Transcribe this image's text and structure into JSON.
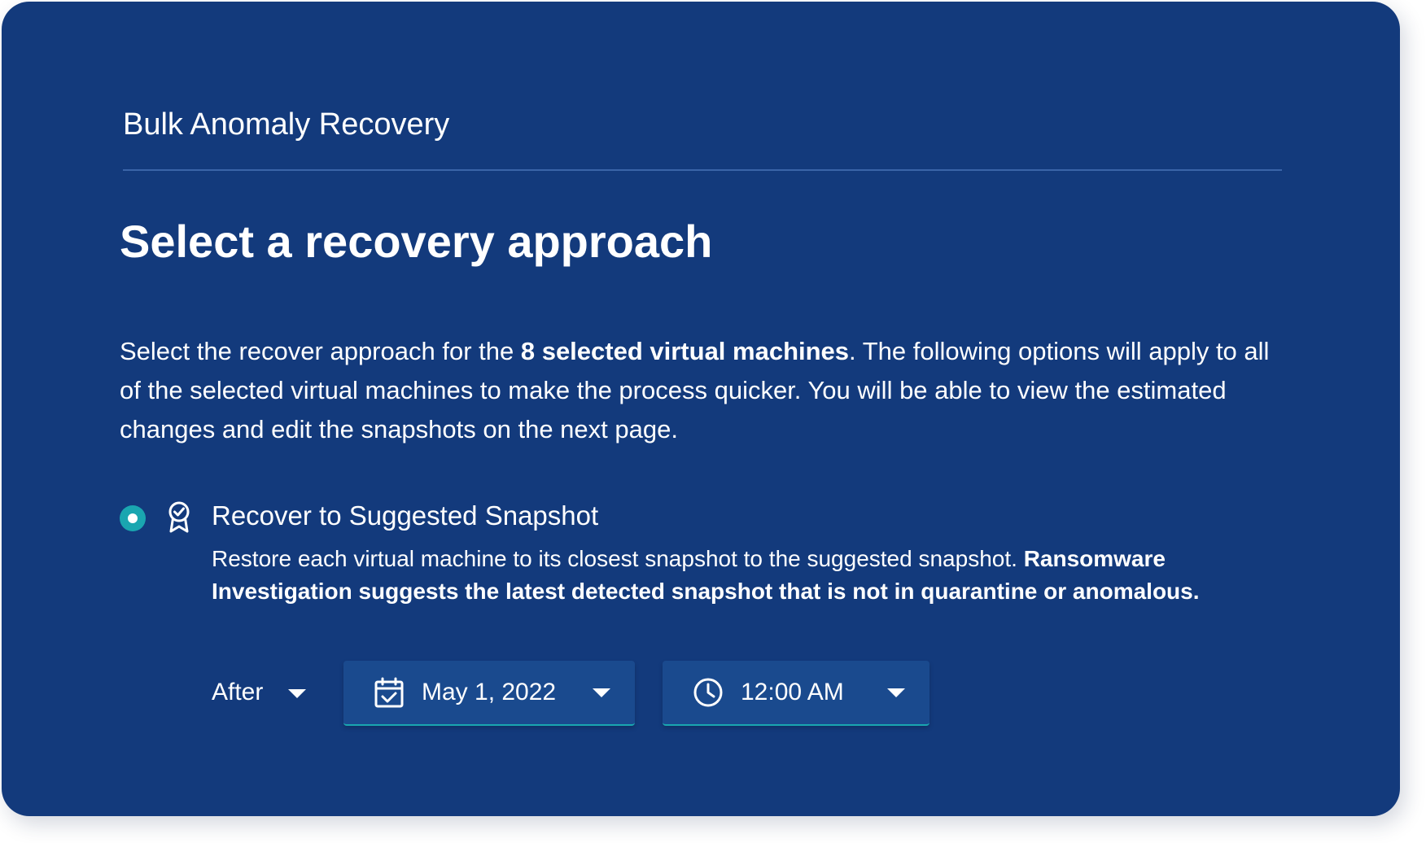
{
  "app": {
    "title": "Bulk Anomaly Recovery"
  },
  "page": {
    "heading": "Select a recovery approach",
    "intro_before": "Select the recover approach for the ",
    "intro_bold": "8 selected virtual machines",
    "intro_after": ". The following options will apply to all of the selected virtual machines to make the process quicker. You will be able to view the estimated changes and edit the snapshots on the next page."
  },
  "option": {
    "selected": true,
    "icon": "award-ribbon-icon",
    "title": "Recover to Suggested Snapshot",
    "desc_before": "Restore each virtual machine to its closest snapshot to the suggested snapshot. ",
    "desc_bold": "Ransomware Investigation suggests the latest detected snapshot that is not in quarantine or anomalous."
  },
  "filters": {
    "relation": {
      "selected": "After",
      "icon": "chevron-down-icon"
    },
    "date": {
      "icon": "calendar-check-icon",
      "value": "May 1, 2022"
    },
    "time": {
      "icon": "clock-icon",
      "value": "12:00 AM"
    }
  },
  "colors": {
    "background": "#133a7c",
    "accent": "#1aa6b0",
    "field": "#1a4a8e",
    "divider": "#3a64a8",
    "text": "#ffffff"
  }
}
